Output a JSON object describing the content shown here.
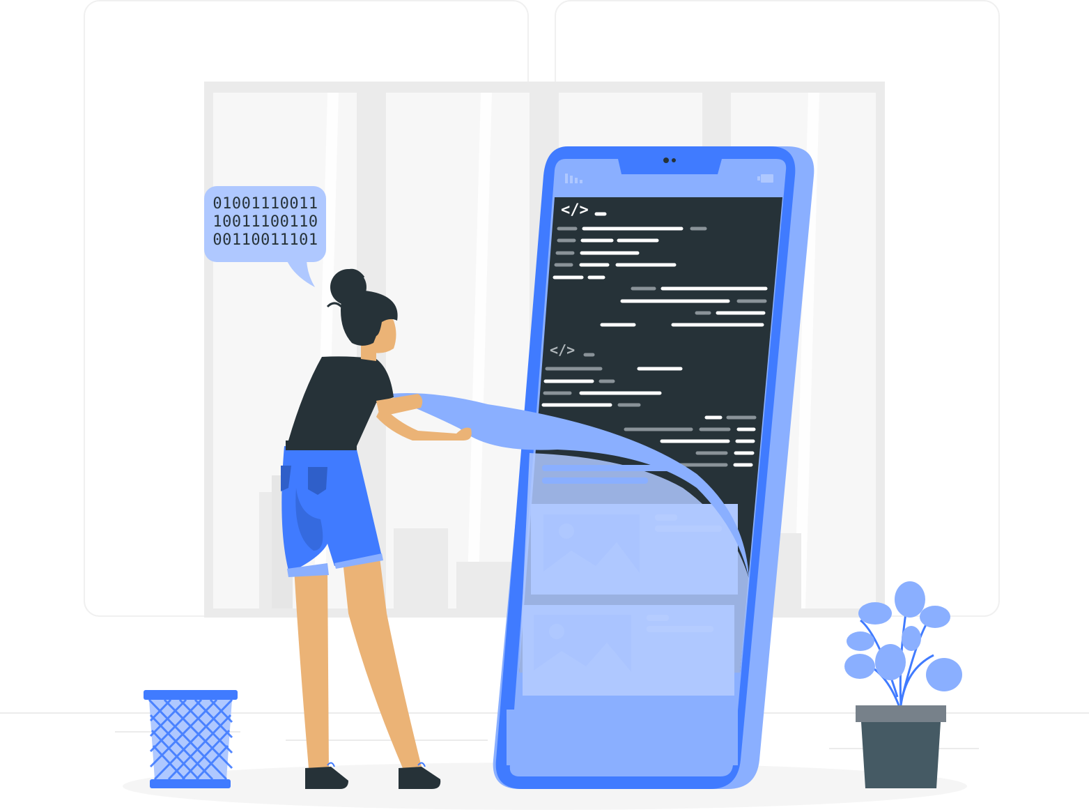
{
  "illustration": {
    "subject": "developer peeling mobile screen to reveal code",
    "colors": {
      "primary": "#407BFF",
      "primary_light": "#8AAFFF",
      "primary_pale": "#AFC8FF",
      "code_bg": "#263238",
      "skin": "#EBB376",
      "pot": "#455A64",
      "wall_gray": "#EBEBEB"
    }
  },
  "speech_bubble": {
    "lines": [
      "01001110011",
      "10011100110",
      "00110011101"
    ]
  },
  "code_screen": {
    "tag_1": "</>",
    "tag_2": "</>"
  }
}
